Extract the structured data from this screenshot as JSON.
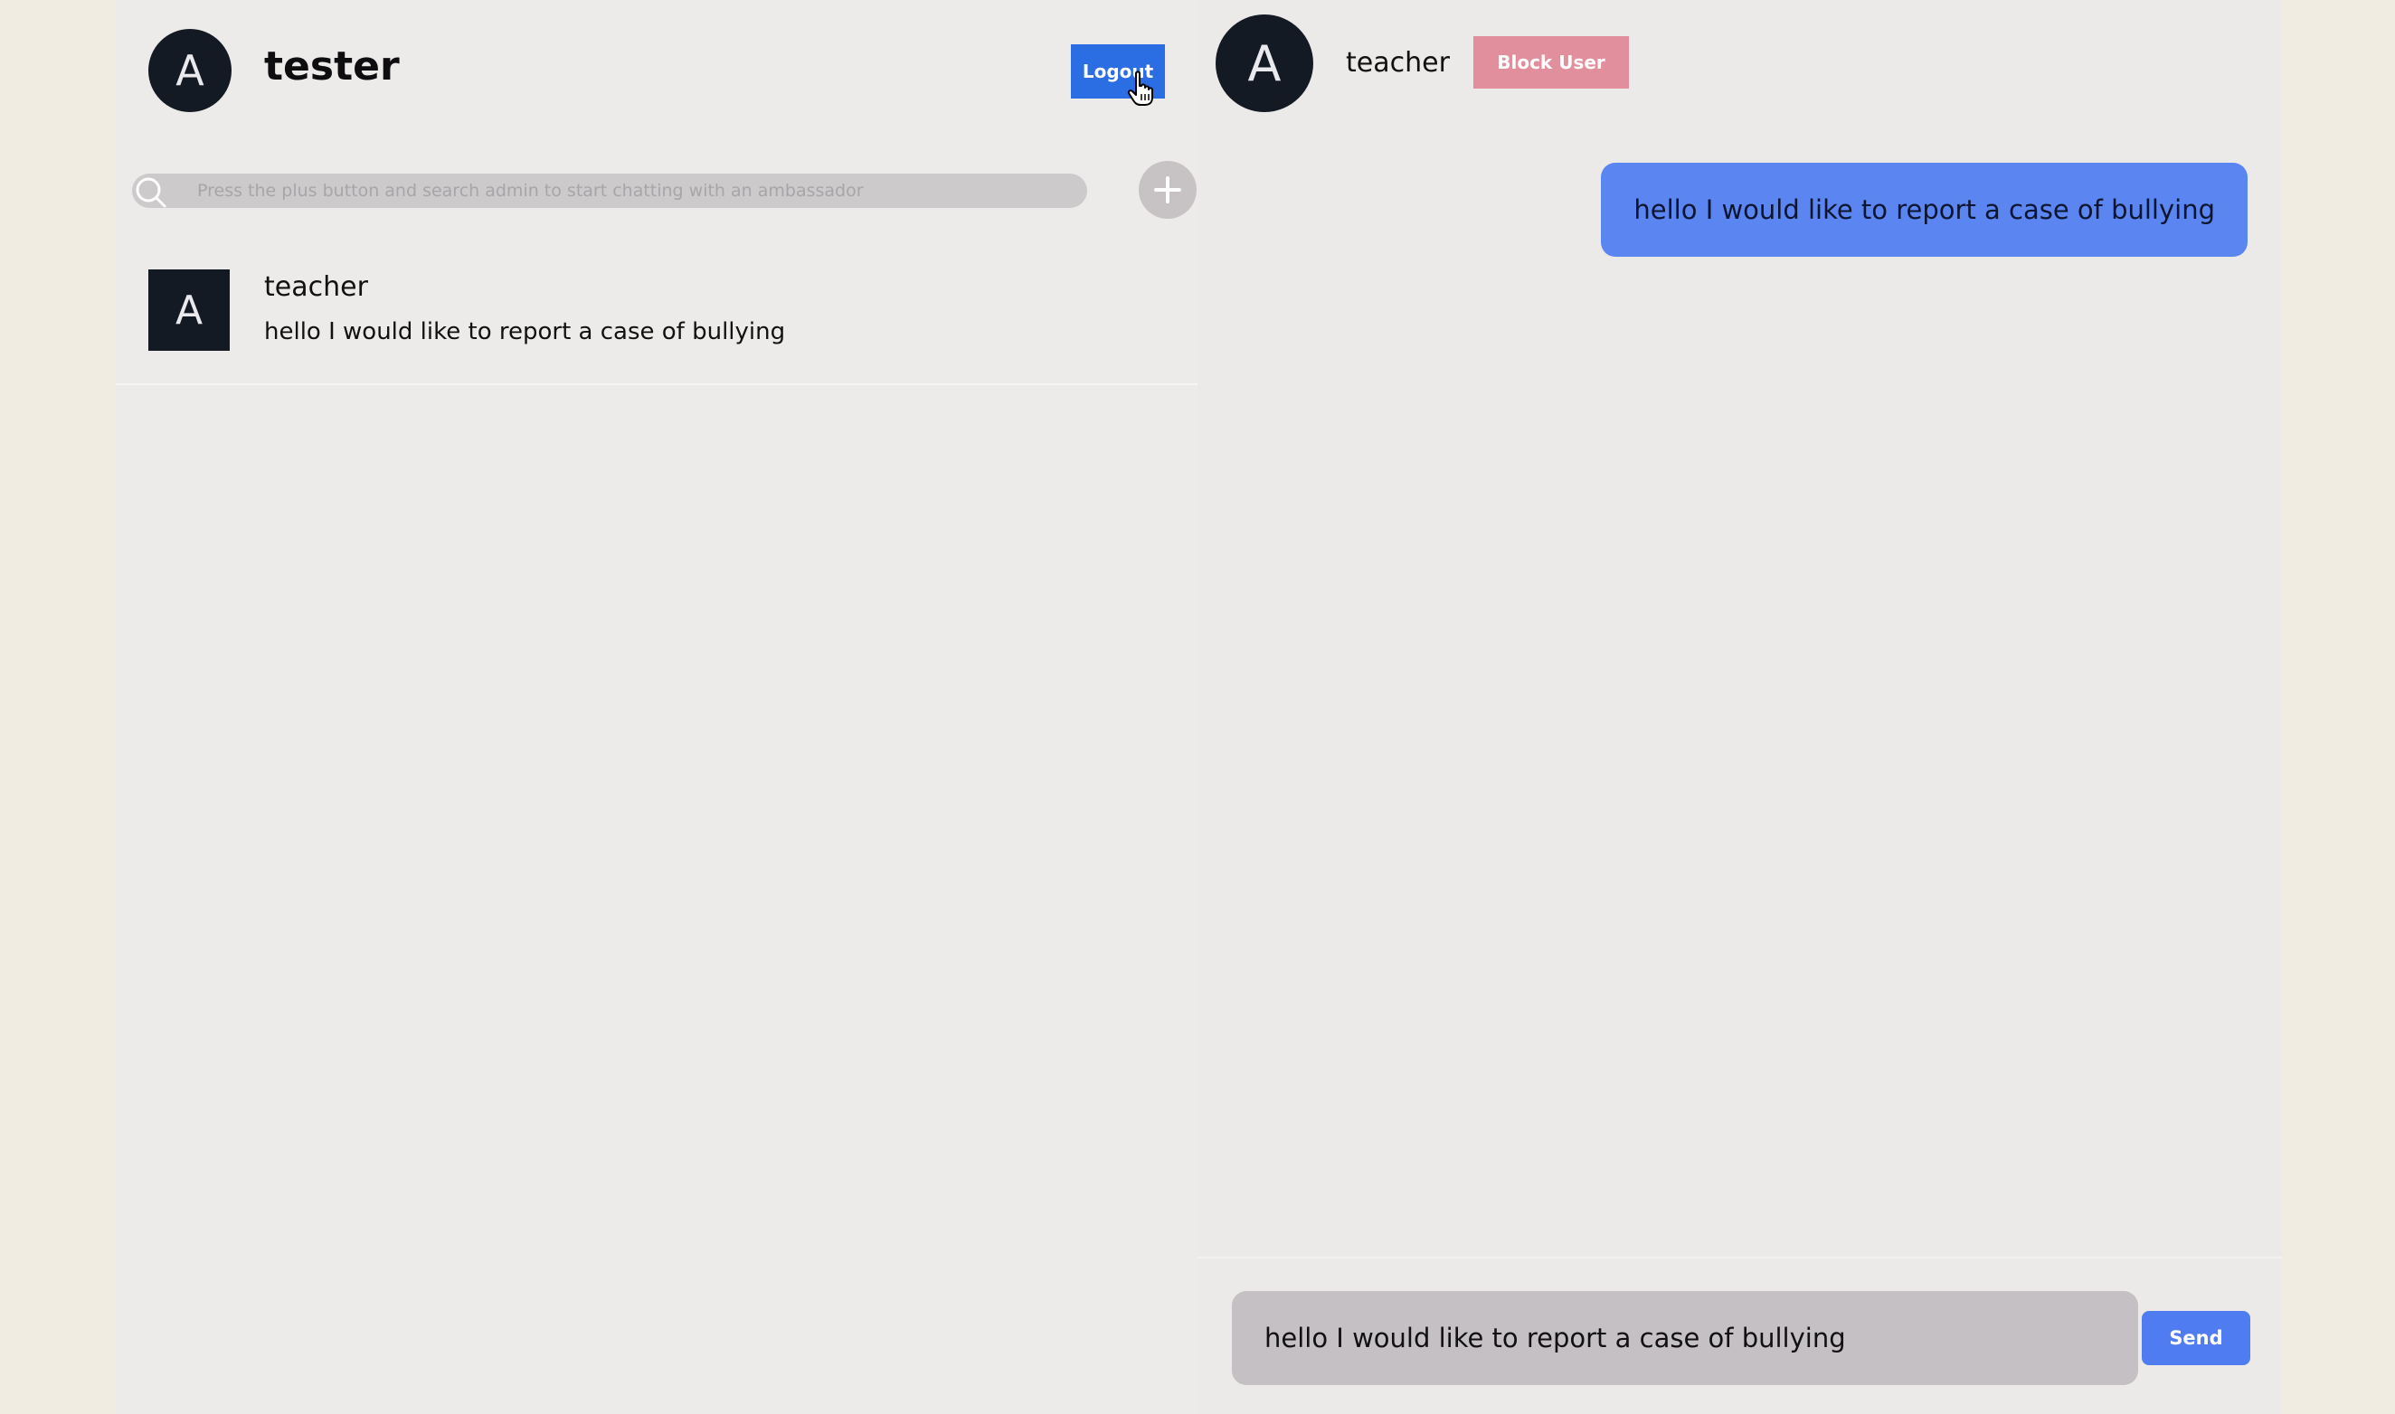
{
  "current_user": {
    "avatar_letter": "A",
    "name": "tester"
  },
  "header": {
    "logout_label": "Logout"
  },
  "search": {
    "placeholder": "Press the plus button and search admin to start chatting with an ambassador",
    "icon": "search-icon",
    "add_icon": "plus-icon"
  },
  "conversations": [
    {
      "avatar_letter": "A",
      "name": "teacher",
      "preview": "hello I would like to report a case of bullying"
    }
  ],
  "chat": {
    "peer": {
      "avatar_letter": "A",
      "name": "teacher"
    },
    "block_label": "Block User",
    "messages": [
      {
        "text": "hello I would like to report a case of bullying",
        "from_me": true
      }
    ]
  },
  "composer": {
    "value": "hello I would like to report a case of bullying",
    "send_label": "Send"
  },
  "colors": {
    "primary": "#2b6de3",
    "bubble": "#5b85f0",
    "block": "#e18f9c",
    "avatar": "#141a24"
  }
}
